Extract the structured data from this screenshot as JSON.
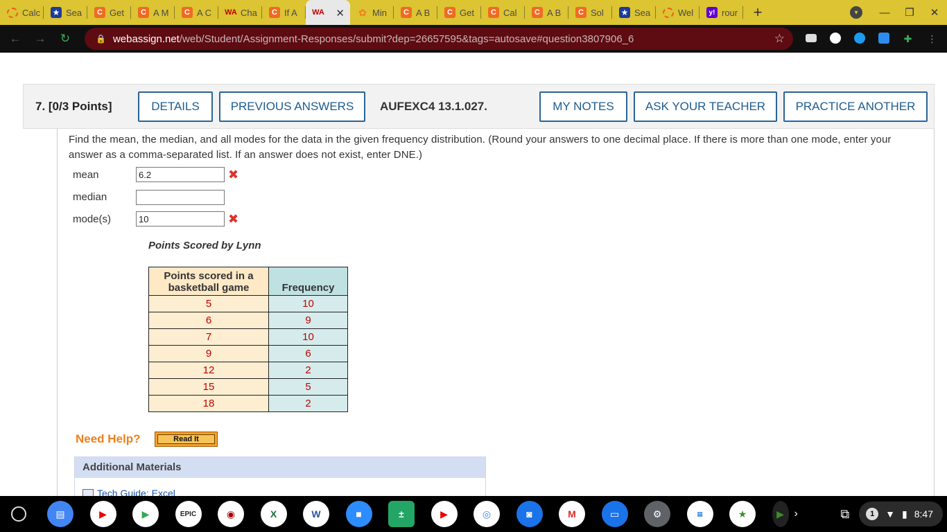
{
  "browser": {
    "tabs": [
      {
        "icon": "ring-icon",
        "glyph": "",
        "label": "Calc"
      },
      {
        "icon": "star-icon",
        "glyph": "★",
        "label": "Sea"
      },
      {
        "icon": "chegg-icon",
        "glyph": "C",
        "label": "Get"
      },
      {
        "icon": "chegg-icon",
        "glyph": "C",
        "label": "A M"
      },
      {
        "icon": "chegg-icon",
        "glyph": "C",
        "label": "A C"
      },
      {
        "icon": "webassign-icon",
        "glyph": "WA",
        "label": "Cha"
      },
      {
        "icon": "chegg-icon",
        "glyph": "C",
        "label": "If A"
      },
      {
        "icon": "webassign-icon",
        "glyph": "WA",
        "label": "",
        "active": true
      },
      {
        "icon": "flower-icon",
        "glyph": "✿",
        "label": "Min"
      },
      {
        "icon": "chegg-icon",
        "glyph": "C",
        "label": "A B"
      },
      {
        "icon": "chegg-icon",
        "glyph": "C",
        "label": "Get"
      },
      {
        "icon": "chegg-icon",
        "glyph": "C",
        "label": "Cal"
      },
      {
        "icon": "chegg-icon",
        "glyph": "C",
        "label": "A B"
      },
      {
        "icon": "chegg-icon",
        "glyph": "C",
        "label": "Sol"
      },
      {
        "icon": "star-icon",
        "glyph": "★",
        "label": "Sea"
      },
      {
        "icon": "ring-icon",
        "glyph": "",
        "label": "Wel"
      },
      {
        "icon": "yahoo-icon",
        "glyph": "y!",
        "label": "rour"
      }
    ],
    "url_host": "webassign.net",
    "url_path": "/web/Student/Assignment-Responses/submit?dep=26657595&tags=autosave#question3807906_6"
  },
  "question": {
    "number_points": "7.  [0/3 Points]",
    "buttons": {
      "details": "DETAILS",
      "previous_answers": "PREVIOUS ANSWERS",
      "my_notes": "MY NOTES",
      "ask_teacher": "ASK YOUR TEACHER",
      "practice_another": "PRACTICE ANOTHER"
    },
    "code": "AUFEXC4 13.1.027.",
    "prompt": "Find the mean, the median, and all modes for the data in the given frequency distribution. (Round your answers to one decimal place. If there is more than one mode, enter your answer as a comma-separated list. If an answer does not exist, enter DNE.)",
    "answers": {
      "mean_label": "mean",
      "mean_value": "6.2",
      "median_label": "median",
      "median_value": "",
      "mode_label": "mode(s)",
      "mode_value": "10"
    },
    "table_title": "Points Scored by Lynn",
    "table_headers": [
      "Points scored in a basketball game",
      "Frequency"
    ],
    "table_rows": [
      [
        "5",
        "10"
      ],
      [
        "6",
        "9"
      ],
      [
        "7",
        "10"
      ],
      [
        "9",
        "6"
      ],
      [
        "12",
        "2"
      ],
      [
        "15",
        "5"
      ],
      [
        "18",
        "2"
      ]
    ],
    "help_label": "Need Help?",
    "read_it": "Read It",
    "additional_materials": "Additional Materials",
    "tech_guide": "Tech Guide: Excel"
  },
  "shelf": {
    "notification_count": "1",
    "time": "8:47"
  },
  "colors": {
    "tabstrip": "#dcc432",
    "omnibox": "#5e0b12",
    "button_border": "#2a6496",
    "wrong_mark": "#e0302a",
    "table_value": "#c00000"
  }
}
